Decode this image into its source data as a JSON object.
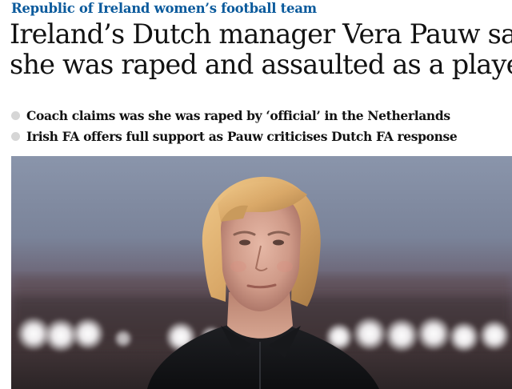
{
  "article": {
    "kicker": "Republic of Ireland women’s football team",
    "headline_lines": [
      "Ireland’s Dutch manager Vera Pauw says",
      "she was raped and assaulted as a player"
    ],
    "standfirst_bullets": [
      "Coach claims was she was raped by ‘official’ in the Netherlands",
      "Irish FA offers full support as Pauw criticises Dutch FA response"
    ]
  },
  "colors": {
    "kicker": "#0a5a9c",
    "headline": "#121212",
    "bullet_dot": "#d6d6d6"
  },
  "photo": {
    "subject": "portrait of a woman with short blonde hair in a dark zip-up jacket, stadium floodlights behind"
  }
}
